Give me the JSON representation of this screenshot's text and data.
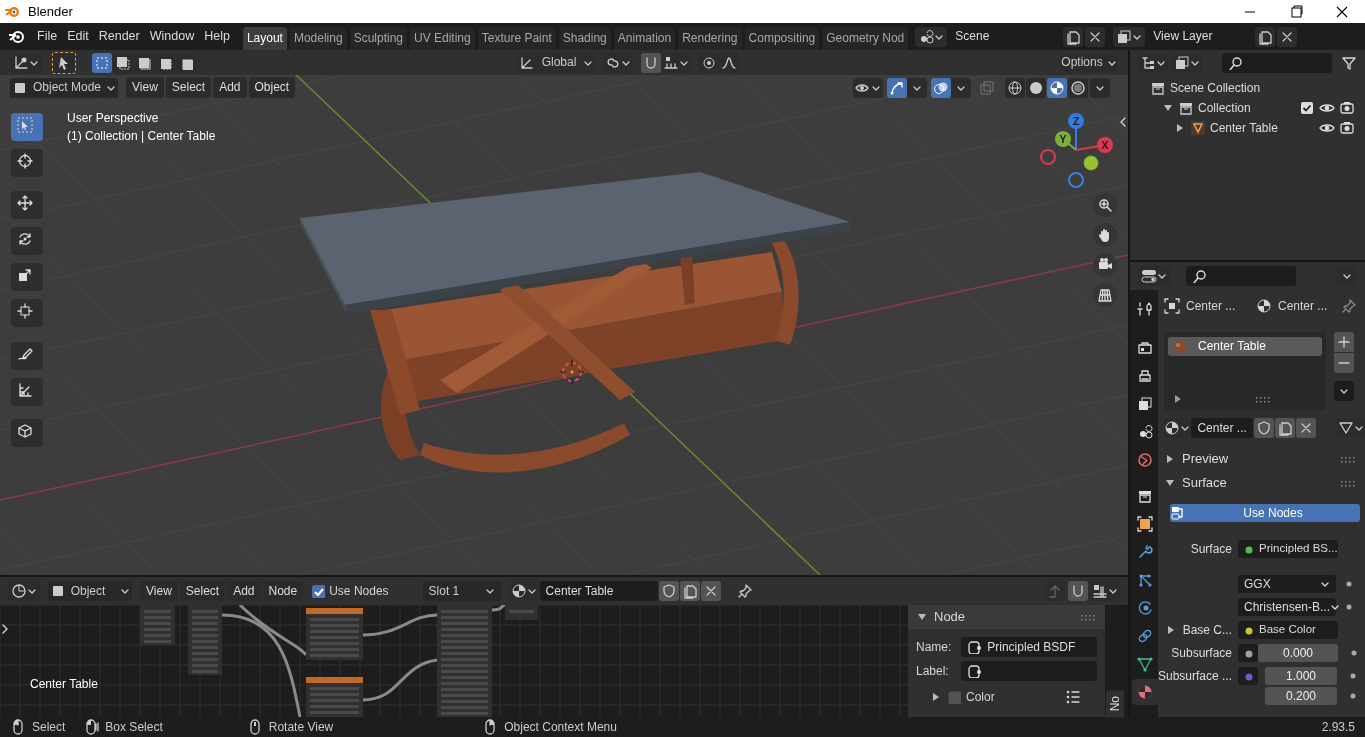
{
  "window": {
    "title": "Blender"
  },
  "menu": [
    "File",
    "Edit",
    "Render",
    "Window",
    "Help"
  ],
  "workspaces": [
    {
      "label": "Layout",
      "selected": true
    },
    {
      "label": "Modeling",
      "selected": false
    },
    {
      "label": "Sculpting",
      "selected": false
    },
    {
      "label": "UV Editing",
      "selected": false
    },
    {
      "label": "Texture Paint",
      "selected": false
    },
    {
      "label": "Shading",
      "selected": false
    },
    {
      "label": "Animation",
      "selected": false
    },
    {
      "label": "Rendering",
      "selected": false
    },
    {
      "label": "Compositing",
      "selected": false
    },
    {
      "label": "Geometry Nod",
      "selected": false
    }
  ],
  "scene": {
    "name": "Scene"
  },
  "view_layer": {
    "name": "View Layer"
  },
  "viewport": {
    "orientation": "Global",
    "options": "Options",
    "select_modes": [
      {
        "selected": true
      },
      {
        "selected": false
      },
      {
        "selected": false
      },
      {
        "selected": false
      },
      {
        "selected": false
      }
    ],
    "mode": "Object Mode",
    "menus": [
      "View",
      "Select",
      "Add",
      "Object"
    ],
    "shading_modes": [
      {
        "kind": "wireframe",
        "selected": false
      },
      {
        "kind": "solid",
        "selected": false
      },
      {
        "kind": "material",
        "selected": true
      },
      {
        "kind": "rendered",
        "selected": false
      }
    ],
    "overlay_text": [
      "User Perspective",
      "(1) Collection | Center Table"
    ],
    "tools": [
      {
        "kind": "select_box",
        "selected": true
      },
      {
        "kind": "cursor",
        "selected": false
      },
      {
        "kind": "move",
        "selected": false
      },
      {
        "kind": "rotate",
        "selected": false
      },
      {
        "kind": "scale",
        "selected": false
      },
      {
        "kind": "transform",
        "selected": false
      },
      {
        "kind": "annotate",
        "selected": false
      },
      {
        "kind": "measure",
        "selected": false
      },
      {
        "kind": "add_cube",
        "selected": false
      }
    ],
    "gizmo_axes": [
      "X",
      "Y",
      "Z"
    ]
  },
  "node_editor": {
    "editor": "Object",
    "menus": [
      "View",
      "Select",
      "Add",
      "Node"
    ],
    "use_nodes": {
      "label": "Use Nodes",
      "checked": true
    },
    "slot": "Slot 1",
    "material": "Center Table",
    "canvas_label": "Center Table",
    "sidebar": {
      "title": "Node",
      "expanded": true,
      "name_label": "Name:",
      "name": "Principled BSDF",
      "label_label": "Label:",
      "color": {
        "label": "Color",
        "checked": false,
        "expanded": false
      },
      "tab": "No"
    }
  },
  "outliner": {
    "items": [
      {
        "label": "Scene Collection",
        "kind": "scene_collection",
        "children": [
          {
            "label": "Collection",
            "kind": "collection",
            "expanded": true,
            "checked": true,
            "children": [
              {
                "label": "Center Table",
                "kind": "object",
                "expanded": false
              }
            ]
          }
        ]
      }
    ]
  },
  "properties": {
    "tabs": [
      {
        "kind": "tool",
        "selected": false
      },
      {
        "kind": "render",
        "selected": false
      },
      {
        "kind": "output",
        "selected": false
      },
      {
        "kind": "view_layer",
        "selected": false
      },
      {
        "kind": "scene",
        "selected": false
      },
      {
        "kind": "world",
        "selected": false
      },
      {
        "kind": "collection",
        "selected": false
      },
      {
        "kind": "object",
        "selected": false
      },
      {
        "kind": "modifiers",
        "selected": false
      },
      {
        "kind": "particles",
        "selected": false
      },
      {
        "kind": "physics",
        "selected": false
      },
      {
        "kind": "constraints",
        "selected": false
      },
      {
        "kind": "data",
        "selected": false
      },
      {
        "kind": "material",
        "selected": true
      }
    ],
    "breadcrumb": [
      "Center ...",
      "Center ..."
    ],
    "slots": [
      {
        "label": "Center Table",
        "selected": true
      }
    ],
    "material": "Center ...",
    "panels": [
      {
        "label": "Preview",
        "expanded": false
      },
      {
        "label": "Surface",
        "expanded": true
      }
    ],
    "use_nodes": "Use Nodes",
    "fields": [
      {
        "kind": "link",
        "label": "Surface",
        "value": "Principled BS...",
        "color": "#4fbf4f"
      },
      {
        "kind": "dropdown",
        "value": "GGX"
      },
      {
        "kind": "dropdown",
        "value": "Christensen-B..."
      },
      {
        "kind": "group",
        "label": "Base C...",
        "value": "Base Color",
        "color": "#c7c729"
      },
      {
        "kind": "number",
        "label": "Subsurface",
        "values": [
          "0.000"
        ],
        "color": "#a1a1a1"
      },
      {
        "kind": "number",
        "label": "Subsurface ...",
        "values": [
          "1.000",
          "0.200"
        ],
        "color": "#6363c7"
      }
    ]
  },
  "status_bar": {
    "hints": [
      {
        "kind": "left",
        "label": "Select"
      },
      {
        "kind": "left_drag",
        "label": "Box Select"
      },
      {
        "kind": "middle",
        "label": "Rotate View"
      },
      {
        "kind": "right",
        "label": "Object Context Menu"
      }
    ],
    "version": "2.93.5"
  }
}
